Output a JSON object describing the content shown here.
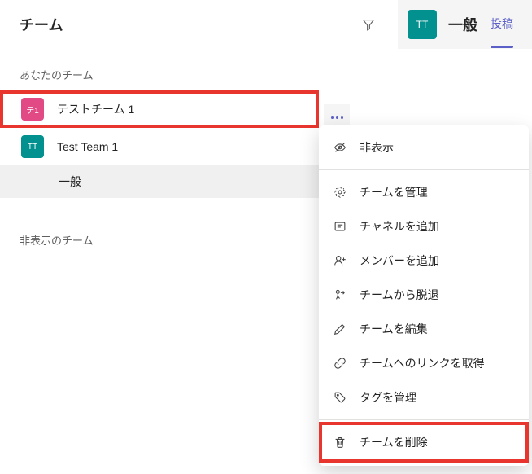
{
  "header": {
    "title": "チーム"
  },
  "channel_header": {
    "avatar": "TT",
    "title": "一般",
    "tab_posts": "投稿"
  },
  "sections": {
    "your_teams": "あなたのチーム",
    "hidden_teams": "非表示のチーム"
  },
  "teams": [
    {
      "avatar": "テ1",
      "name": "テストチーム 1"
    },
    {
      "avatar": "TT",
      "name": "Test Team 1"
    }
  ],
  "channel_general": "一般",
  "menu": {
    "hide": "非表示",
    "manage_team": "チームを管理",
    "add_channel": "チャネルを追加",
    "add_member": "メンバーを追加",
    "leave_team": "チームから脱退",
    "edit_team": "チームを編集",
    "get_link": "チームへのリンクを取得",
    "manage_tags": "タグを管理",
    "delete_team": "チームを削除"
  }
}
